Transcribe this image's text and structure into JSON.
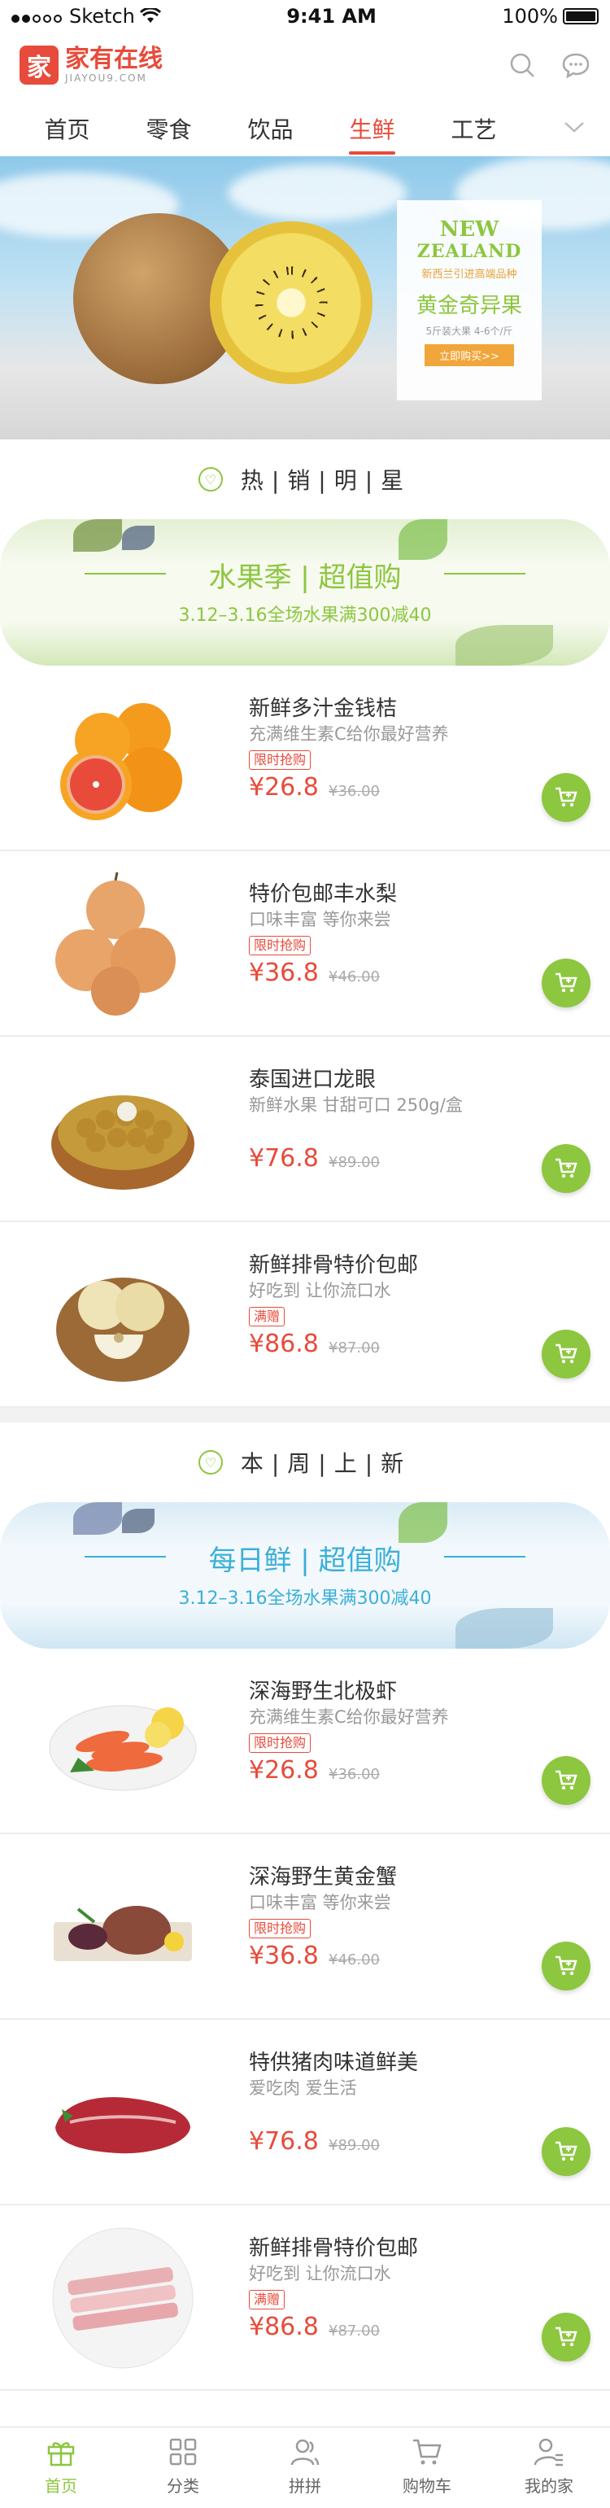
{
  "status_bar": {
    "carrier": "Sketch",
    "time": "9:41 AM",
    "battery": "100%"
  },
  "header": {
    "logo_mark": "家",
    "logo_cn": "家有在线",
    "logo_en": "JIAYOU9.COM",
    "icons": [
      "search-icon",
      "message-icon"
    ]
  },
  "nav": {
    "tabs": [
      "首页",
      "零食",
      "饮品",
      "生鲜",
      "工艺"
    ],
    "active_index": 3,
    "more_icon": "chevron-down-icon"
  },
  "banner": {
    "line1": "NEW",
    "line2": "ZEALAND",
    "subtitle": "新西兰引进高端品种",
    "title": "黄金奇异果",
    "spec": "5斤装大果 4-6个/斤",
    "button": "立即购买>>"
  },
  "sections": [
    {
      "title": "热|销|明|星",
      "strip_title": "水果季 | 超值购",
      "strip_note": "3.12–3.16全场水果满300减40",
      "products": [
        {
          "name": "新鲜多汁金钱桔",
          "desc": "充满维生素C给你最好营养",
          "tag": "限时抢购",
          "price": "¥26.8",
          "old_price": "¥36.00",
          "image": "oranges"
        },
        {
          "name": "特价包邮丰水梨",
          "desc": "口味丰富 等你来尝",
          "tag": "限时抢购",
          "price": "¥36.8",
          "old_price": "¥46.00",
          "image": "pears"
        },
        {
          "name": "泰国进口龙眼",
          "desc": "新鲜水果 甘甜可口 250g/盒",
          "tag": "",
          "price": "¥76.8",
          "old_price": "¥89.00",
          "image": "longan"
        },
        {
          "name": "新鲜排骨特价包邮",
          "desc": "好吃到 让你流口水",
          "tag": "满赠",
          "price": "¥86.8",
          "old_price": "¥87.00",
          "image": "pears-basket"
        }
      ]
    },
    {
      "title": "本|周|上|新",
      "strip_title": "每日鲜 | 超值购",
      "strip_note": "3.12–3.16全场水果满300减40",
      "products": [
        {
          "name": "深海野生北极虾",
          "desc": "充满维生素C给你最好营养",
          "tag": "限时抢购",
          "price": "¥26.8",
          "old_price": "¥36.00",
          "image": "shrimp"
        },
        {
          "name": "深海野生黄金蟹",
          "desc": "口味丰富 等你来尝",
          "tag": "限时抢购",
          "price": "¥36.8",
          "old_price": "¥46.00",
          "image": "crab"
        },
        {
          "name": "特供猪肉味道鲜美",
          "desc": "爱吃肉  爱生活",
          "tag": "",
          "price": "¥76.8",
          "old_price": "¥89.00",
          "image": "pork"
        },
        {
          "name": "新鲜排骨特价包邮",
          "desc": "好吃到 让你流口水",
          "tag": "满赠",
          "price": "¥86.8",
          "old_price": "¥87.00",
          "image": "bacon"
        }
      ]
    }
  ],
  "tabbar": {
    "items": [
      {
        "label": "首页",
        "icon": "gift-icon"
      },
      {
        "label": "分类",
        "icon": "grid-icon"
      },
      {
        "label": "拼拼",
        "icon": "users-icon"
      },
      {
        "label": "购物车",
        "icon": "cart-icon"
      },
      {
        "label": "我的家",
        "icon": "profile-icon"
      }
    ],
    "active_index": 0
  },
  "colors": {
    "accent": "#e74b3b",
    "green": "#8dc63f",
    "blue": "#3ab0d8"
  }
}
